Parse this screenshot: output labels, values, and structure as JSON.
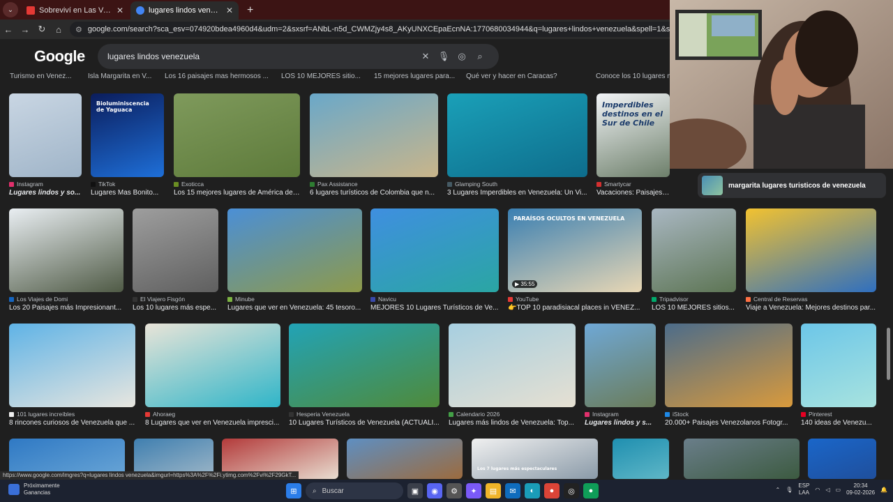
{
  "tabs": [
    {
      "title": "Sobreviví en Las Vegas SOLO c",
      "favicon_color": "#e53935",
      "active": false
    },
    {
      "title": "lugares lindos venezuela - Busc",
      "favicon_color": "#4285f4",
      "active": true
    }
  ],
  "address": {
    "url": "google.com/search?sca_esv=074920bdea4960d4&udm=2&sxsrf=ANbL-n5d_CWMZjy4s8_AKyUNXCEpaEcnNA:1770680034944&q=lugares+lindos+venezuela&spell=1&sa=X&ved=2ahUKEwiwpPmTyc2S"
  },
  "google": {
    "logo": "Google",
    "query": "lugares lindos venezuela"
  },
  "chips": [
    "Turismo en Venez...",
    "Isla Margarita en V...",
    "Los 16 paisajes mas hermosos ...",
    "LOS 10 MEJORES sitio...",
    "15 mejores lugares para...",
    "Qué ver y hacer en Caracas?",
    "Conoce los 10 lugares m"
  ],
  "rows": [
    [
      {
        "source": "Instagram",
        "caption": "Lugares lindos y so...",
        "italic": true,
        "src_color": "#e1306c",
        "img": [
          "#c9d6e3",
          "#9fb4c8"
        ]
      },
      {
        "source": "TikTok",
        "caption": "Lugares Mas Bonito...",
        "italic": false,
        "src_color": "#111111",
        "img": [
          "#0b1d5c",
          "#1e6fd8"
        ],
        "overlay": "Bioluminiscencia de Yaguaca"
      },
      {
        "source": "Exoticca",
        "caption": "Los 15 mejores lugares de América del...",
        "italic": false,
        "src_color": "#6b8e23",
        "img": [
          "#7f9a5c",
          "#5d7a3a"
        ]
      },
      {
        "source": "Pax Assistance",
        "caption": "6 lugares turísticos de Colombia que n...",
        "italic": false,
        "src_color": "#2e7d32",
        "img": [
          "#6aa8c9",
          "#c9b58a"
        ]
      },
      {
        "source": "Glamping South",
        "caption": "3 Lugares Imperdibles en Venezuela: Un Vi...",
        "italic": false,
        "src_color": "#455a64",
        "img": [
          "#1aa0b8",
          "#0e6d8c"
        ]
      },
      {
        "source": "Smartycar",
        "caption": "Vacaciones: Paisajes del S...",
        "italic": false,
        "src_color": "#d32f2f",
        "img": [
          "#f2f4f7",
          "#6d7f6a"
        ],
        "overlay": "Imperdibles destinos en el Sur de Chile"
      }
    ],
    [
      {
        "source": "Los Viajes de Domi",
        "caption": "Los 20 Paisajes más Impresionant...",
        "italic": false,
        "src_color": "#1565c0",
        "img": [
          "#e9eef2",
          "#4f5a45"
        ]
      },
      {
        "source": "El Viajero Fisgón",
        "caption": "Los 10 lugares más espe...",
        "italic": false,
        "src_color": "#333333",
        "img": [
          "#9e9e9e",
          "#5f5f5f"
        ]
      },
      {
        "source": "Minube",
        "caption": "Lugares que ver en Venezuela: 45 tesoro...",
        "italic": false,
        "src_color": "#7cb342",
        "img": [
          "#4b8fd6",
          "#8e9a4a"
        ]
      },
      {
        "source": "Navicu",
        "caption": "MEJORES 10 Lugares Turísticos de Ve...",
        "italic": false,
        "src_color": "#3949ab",
        "img": [
          "#3f8fe0",
          "#2aa6a3"
        ]
      },
      {
        "source": "YouTube",
        "caption": "👉TOP 10 paradisiacal places in VENEZ...",
        "italic": false,
        "src_color": "#e53935",
        "img": [
          "#3a7fb2",
          "#e8d7b4"
        ],
        "overlay": "PARAÍSOS OCULTOS EN VENEZUELA",
        "badge": "▶ 35:55"
      },
      {
        "source": "Tripadvisor",
        "caption": "LOS 10 MEJORES sitios...",
        "italic": false,
        "src_color": "#00aa6c",
        "img": [
          "#a9b7c2",
          "#5d7554"
        ]
      },
      {
        "source": "Central de Reservas",
        "caption": "Viaje a Venezuela: Mejores destinos par...",
        "italic": false,
        "src_color": "#ff7043",
        "img": [
          "#f2c230",
          "#2f6fbf"
        ]
      }
    ],
    [
      {
        "source": "101 lugares increíbles",
        "caption": "8 rincones curiosos de Venezuela que ...",
        "italic": false,
        "src_color": "#eeeeee",
        "img": [
          "#5fb3e6",
          "#e8e6df"
        ]
      },
      {
        "source": "Ahoraeg",
        "caption": "8 Lugares que ver en Venezuela impresci...",
        "italic": false,
        "src_color": "#e53935",
        "img": [
          "#e9e4d8",
          "#2fb5c8"
        ]
      },
      {
        "source": "Hesperia Venezuela",
        "caption": "10 Lugares Turísticos de Venezuela (ACTUALI...",
        "italic": false,
        "src_color": "#333333",
        "img": [
          "#22a3b6",
          "#4f8a3a"
        ]
      },
      {
        "source": "Calendario 2026",
        "caption": "Lugares más lindos de Venezuela: Top...",
        "italic": false,
        "src_color": "#43a047",
        "img": [
          "#a7cfe0",
          "#e6e0d2"
        ]
      },
      {
        "source": "Instagram",
        "caption": "Lugares lindos y s...",
        "italic": true,
        "src_color": "#e1306c",
        "img": [
          "#6fa8d6",
          "#6a7c5a"
        ]
      },
      {
        "source": "iStock",
        "caption": "20.000+ Paisajes Venezolanos Fotogr...",
        "italic": false,
        "src_color": "#1e88e5",
        "img": [
          "#4c6c8a",
          "#d99a3c"
        ]
      },
      {
        "source": "Pinterest",
        "caption": "140 ideas de Venezu...",
        "italic": false,
        "src_color": "#e60023",
        "img": [
          "#6cc6e8",
          "#a8e3df"
        ]
      }
    ],
    [
      {
        "img": [
          "#2f79c4",
          "#6aa6d6"
        ]
      },
      {
        "img": [
          "#3f7fb0",
          "#9fb7c7"
        ]
      },
      {
        "img": [
          "#b33a3a",
          "#e8ddd0"
        ]
      },
      {
        "img": [
          "#5e8fc2",
          "#9c6b3e"
        ]
      },
      {
        "img": [
          "#f0f0f0",
          "#8a9aa8"
        ],
        "overlay": "Los 7 lugares más espectaculares"
      },
      {
        "img": [
          "#1f8fb0",
          "#5fb7c7"
        ]
      },
      {
        "img": [
          "#6a7e8a",
          "#3c5a40"
        ]
      },
      {
        "img": [
          "#1a66c9",
          "#1f4f9c"
        ]
      }
    ]
  ],
  "side_suggestion": "margarita lugares turisticos de venezuela",
  "status_url": "https://www.google.com/imgres?q=lugares lindos venezuela&imgurl=https%3A%2F%2Fi.ytimg.com%2Fvi%2F29GkT...",
  "taskbar": {
    "weather_line1": "Próximamente",
    "weather_line2": "Ganancias",
    "search_label": "Buscar",
    "lang1": "ESP",
    "lang2": "LAA",
    "time": "20:34",
    "date": "09-02-2026"
  }
}
